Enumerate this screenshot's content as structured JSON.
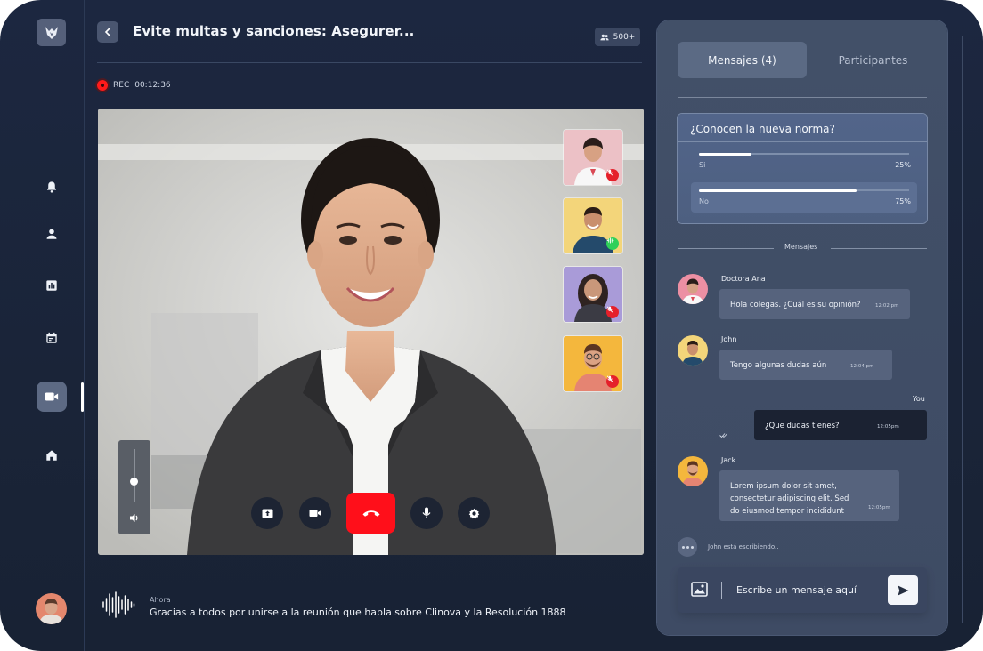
{
  "header": {
    "title": "Evite multas y sanciones: Asegurer...",
    "participants_count": "500+",
    "rec_label": "REC",
    "rec_time": "00:12:36"
  },
  "tabs": [
    {
      "label": "Mensajes (4)",
      "active": true
    },
    {
      "label": "Participantes",
      "active": false
    }
  ],
  "poll": {
    "question": "¿Conocen la nueva norma?",
    "options": [
      {
        "label": "Si",
        "percent": "25%",
        "value": 0.25,
        "selected": false
      },
      {
        "label": "No",
        "percent": "75%",
        "value": 0.75,
        "selected": true
      }
    ]
  },
  "chat": {
    "section_label": "Mensajes",
    "messages": [
      {
        "sender": "Doctora Ana",
        "text": "Hola colegas. ¿Cuál es su opinión?",
        "time": "12:02 pm"
      },
      {
        "sender": "John",
        "text": "Tengo algunas dudas aún",
        "time": "12:04 pm"
      },
      {
        "sender": "You",
        "text": "¿Que dudas tienes?",
        "time": "12:05pm",
        "own": true
      },
      {
        "sender": "Jack",
        "text_lines": [
          "Lorem ipsum dolor sit amet,",
          "consectetur adipiscing elit. Sed",
          "do eiusmod tempor incididunt"
        ],
        "time": "12:05pm"
      }
    ],
    "typing": "John está escribiendo..",
    "composer_placeholder": "Escribe un mensaje aquí"
  },
  "transcript": {
    "time": "Ahora",
    "text": "Gracias a todos por unirse a la reunión que habla sobre Clinova y la Resolución 1888"
  },
  "colors": {
    "background": "#1b2539",
    "panel": "#404d66",
    "accent_red": "#ff0f1a",
    "mic_on": "#2fd05a"
  },
  "icons": {
    "rail": [
      "bell-icon",
      "user-icon",
      "chart-icon",
      "calendar-icon",
      "video-icon",
      "home-icon"
    ],
    "controls": [
      "share-screen-icon",
      "camera-icon",
      "hang-up-icon",
      "microphone-icon",
      "settings-icon"
    ]
  }
}
